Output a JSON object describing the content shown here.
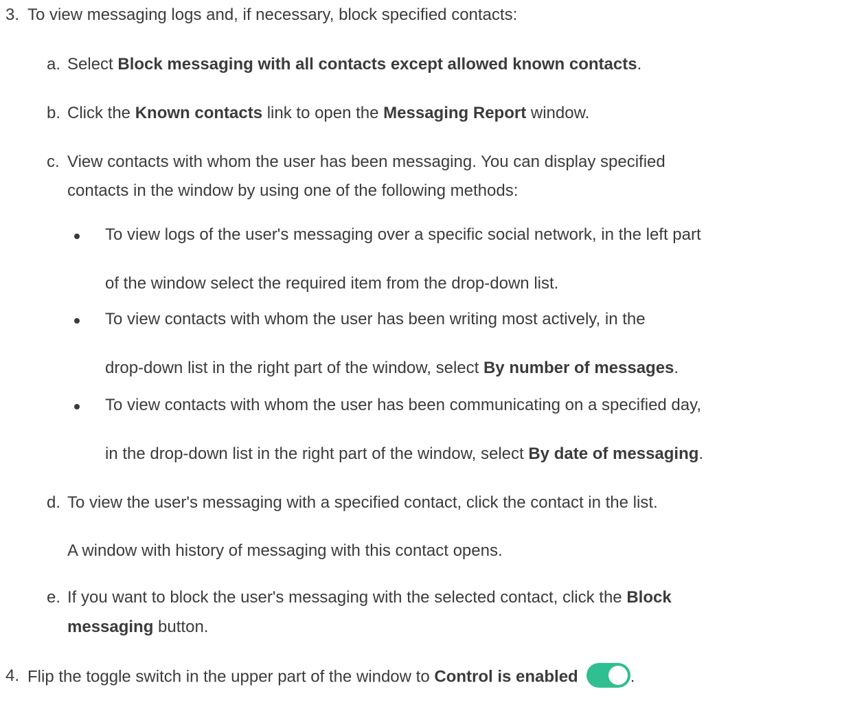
{
  "steps": [
    {
      "marker": "3.",
      "text": "To view messaging logs and, if necessary, block specified contacts:",
      "substeps": [
        {
          "marker": "a.",
          "pre": "Select ",
          "bold": "Block messaging with all contacts except allowed known contacts",
          "post": "."
        },
        {
          "marker": "b.",
          "pre": "Click the ",
          "bold1": "Known contacts",
          "mid": " link to open the ",
          "bold2": "Messaging Report",
          "post": " window."
        },
        {
          "marker": "c.",
          "line1": "View contacts with whom the user has been messaging. You can display specified",
          "line2": "contacts in the window by using one of the following methods:",
          "bullets": [
            {
              "line1": "To view logs of the user's messaging over a specific social network, in the left part",
              "line2": "of the window select the required item from the drop-down list."
            },
            {
              "line1": "To view contacts with whom the user has been writing most actively, in the",
              "line2_pre": "drop-down list in the right part of the window, select ",
              "line2_bold": "By number of messages",
              "line2_post": "."
            },
            {
              "line1": "To view contacts with whom the user has been communicating on a specified day,",
              "line2_pre": "in the drop-down list in the right part of the window, select ",
              "line2_bold": "By date of messaging",
              "line2_post": "."
            }
          ]
        },
        {
          "marker": "d.",
          "text": "To view the user's messaging with a specified contact, click the contact in the list.",
          "note": "A window with history of messaging with this contact opens."
        },
        {
          "marker": "e.",
          "line1_pre": "If you want to block the user's messaging with the selected contact, click the ",
          "line1_bold": "Block",
          "line2_bold": "messaging",
          "line2_post": " button."
        }
      ]
    },
    {
      "marker": "4.",
      "pre": "Flip the toggle switch in the upper part of the window to ",
      "bold": "Control is enabled",
      "post": ".",
      "toggle_icon": "toggle-switch-on-icon",
      "toggle_color": "#2fbf91"
    }
  ]
}
